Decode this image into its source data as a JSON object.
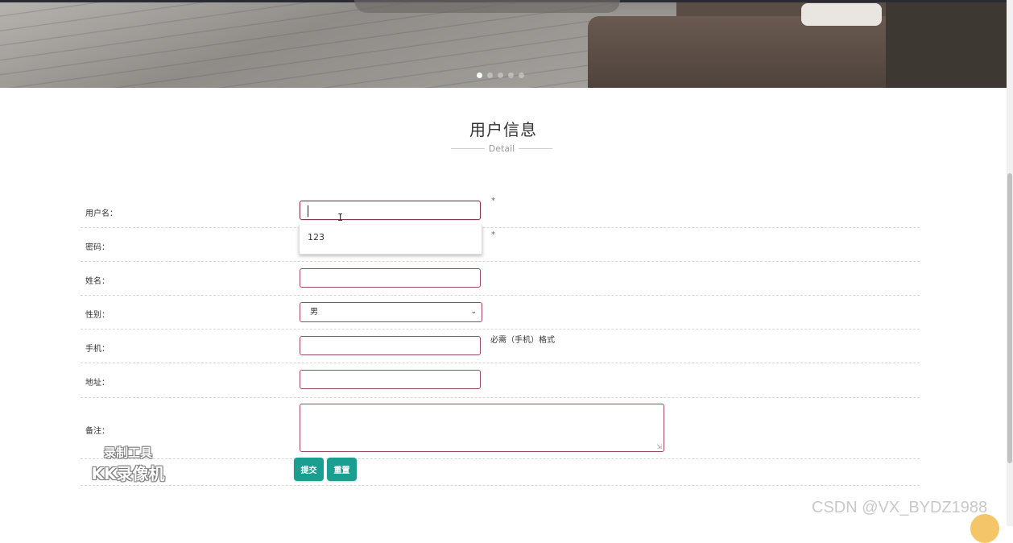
{
  "banner": {
    "slide_count": 5,
    "active_slide": 1
  },
  "header": {
    "title": "用户信息",
    "subtitle": "Detail"
  },
  "form": {
    "username": {
      "label": "用户名：",
      "value": "",
      "required_mark": "*"
    },
    "autocomplete": {
      "option": "123"
    },
    "password": {
      "label": "密码：",
      "required_mark": "*"
    },
    "name": {
      "label": "姓名：",
      "value": ""
    },
    "gender": {
      "label": "性别：",
      "selected": "男"
    },
    "phone": {
      "label": "手机：",
      "value": "",
      "hint": "必需（手机）格式"
    },
    "address": {
      "label": "地址：",
      "value": ""
    },
    "remark": {
      "label": "备注：",
      "value": ""
    },
    "submit_label": "提交",
    "reset_label": "重置"
  },
  "watermark": {
    "tool_line1": "录制工具",
    "tool_line2": "KK录像机",
    "csdn": "CSDN @VX_BYDZ1988"
  },
  "colors": {
    "accent": "#1a9e8f",
    "input_border": "#9a4a5e"
  }
}
